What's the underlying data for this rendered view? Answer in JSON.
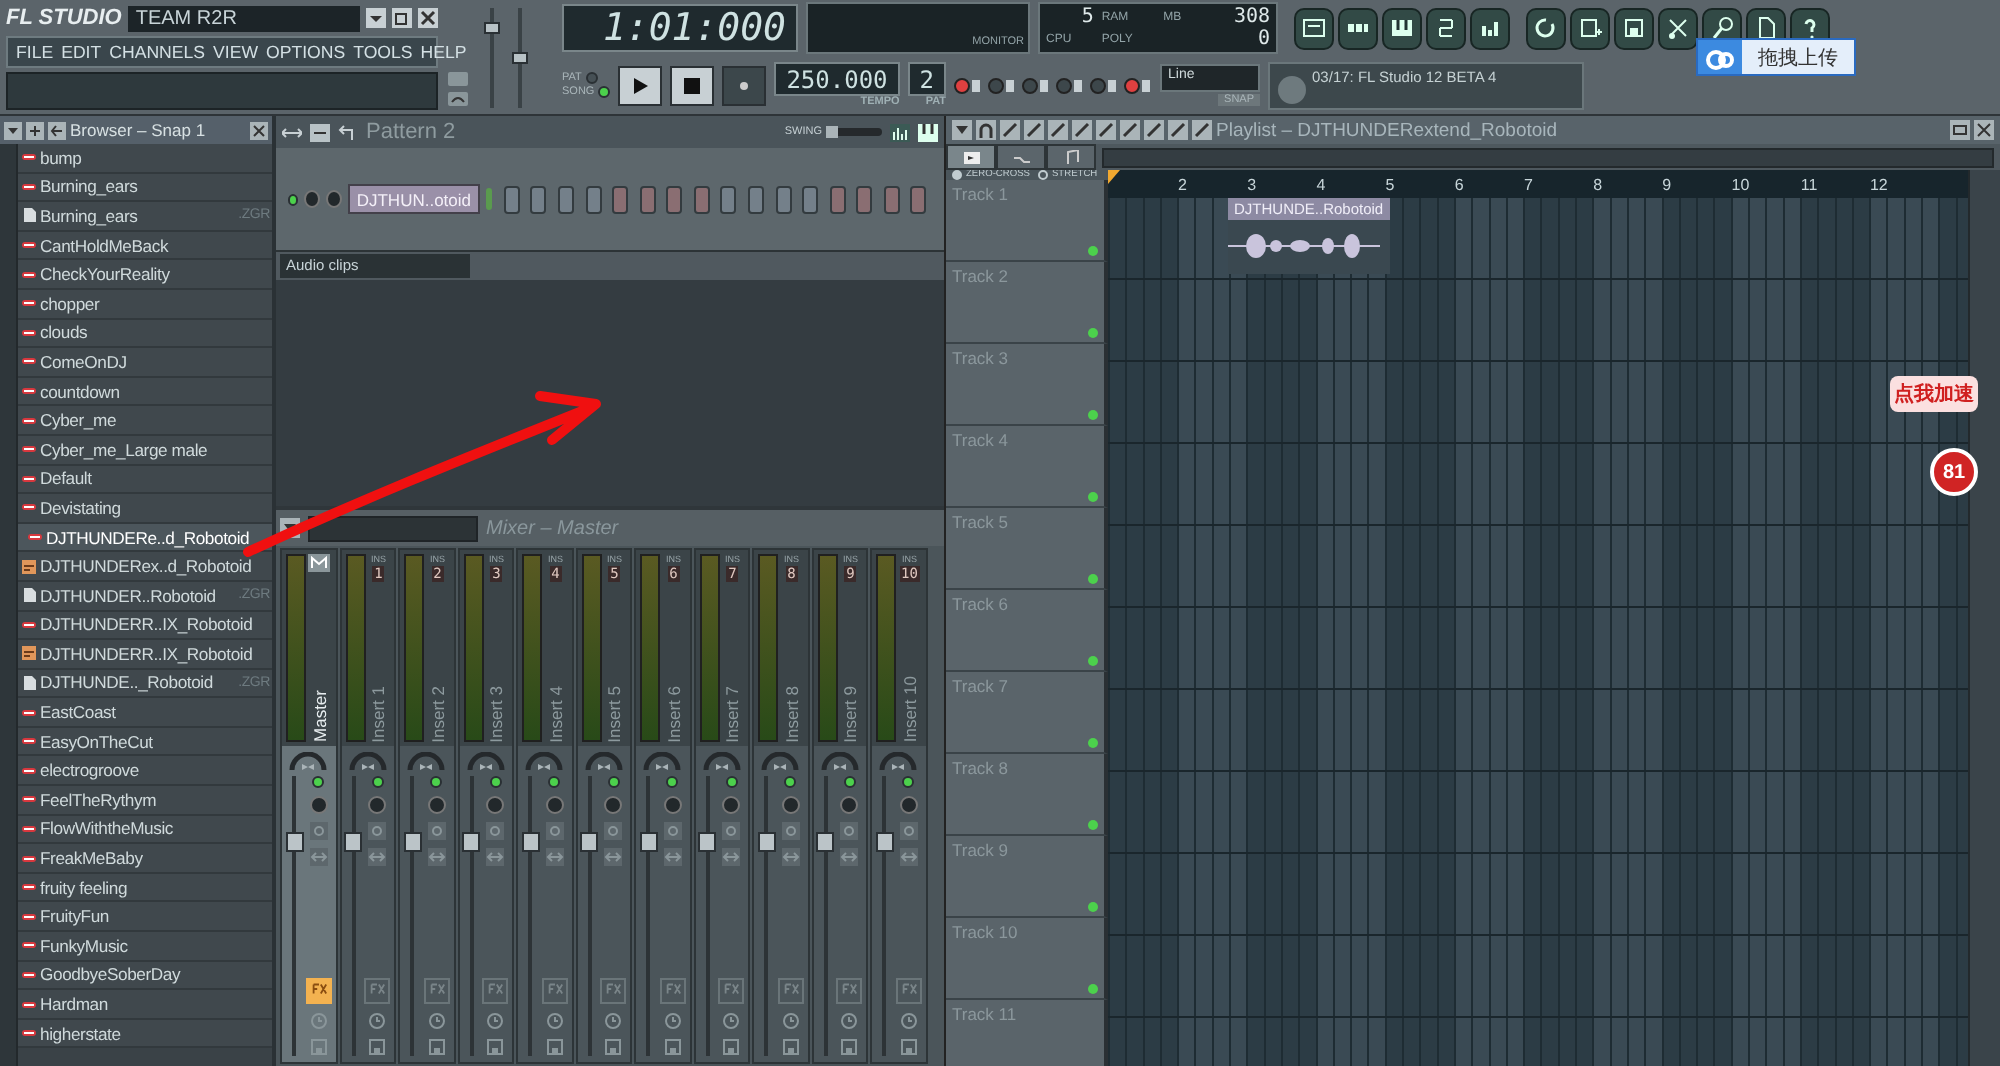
{
  "window": {
    "logo": "FL STUDIO",
    "title": "TEAM R2R"
  },
  "menu": [
    "FILE",
    "EDIT",
    "CHANNELS",
    "VIEW",
    "OPTIONS",
    "TOOLS",
    "HELP"
  ],
  "master_sliders": [
    {
      "level": 0.8
    },
    {
      "level": 0.5
    }
  ],
  "transport": {
    "time": "1:01:000",
    "modes": [
      {
        "label": "PAT",
        "selected": false
      },
      {
        "label": "SONG",
        "selected": true
      }
    ],
    "tempo": "250.000",
    "tempo_label": "TEMPO",
    "pattern": "2",
    "pattern_label": "PAT"
  },
  "monitor": {
    "label": "MONITOR"
  },
  "cpu": {
    "value_1": "5",
    "value_2": "308",
    "ram_label": "RAM",
    "mb_label": "MB",
    "cpu_label": "CPU",
    "poly_label": "POLY",
    "poly": "0"
  },
  "snap": {
    "value": "Line",
    "label": "SNAP"
  },
  "news": "03/17: FL Studio 12 BETA 4",
  "upload_tip": "拖拽上传",
  "browser": {
    "title": "Browser – Snap 1",
    "items": [
      {
        "label": "bump",
        "kind": "preset",
        "selected": false
      },
      {
        "label": "Burning_ears",
        "kind": "preset",
        "selected": false
      },
      {
        "label": "Burning_ears",
        "ext": ".ZGR",
        "kind": "file",
        "selected": false
      },
      {
        "label": "CantHoldMeBack",
        "kind": "preset",
        "selected": false
      },
      {
        "label": "CheckYourReality",
        "kind": "preset",
        "selected": false
      },
      {
        "label": "chopper",
        "kind": "preset",
        "selected": false
      },
      {
        "label": "clouds",
        "kind": "preset",
        "selected": false
      },
      {
        "label": "ComeOnDJ",
        "kind": "preset",
        "selected": false
      },
      {
        "label": "countdown",
        "kind": "preset",
        "selected": false
      },
      {
        "label": "Cyber_me",
        "kind": "preset",
        "selected": false
      },
      {
        "label": "Cyber_me_Large male",
        "kind": "preset",
        "selected": false
      },
      {
        "label": "Default",
        "kind": "preset",
        "selected": false
      },
      {
        "label": "Devistating",
        "kind": "preset",
        "selected": false
      },
      {
        "label": "DJTHUNDERe..d_Robotoid",
        "kind": "preset",
        "selected": true
      },
      {
        "label": "DJTHUNDERex..d_Robotoid",
        "kind": "audio",
        "selected": false
      },
      {
        "label": "DJTHUNDER..Robotoid",
        "ext": ".ZGR",
        "kind": "file",
        "selected": false
      },
      {
        "label": "DJTHUNDERR..IX_Robotoid",
        "kind": "preset",
        "selected": false
      },
      {
        "label": "DJTHUNDERR..IX_Robotoid",
        "kind": "audio",
        "selected": false
      },
      {
        "label": "DJTHUNDE.._Robotoid",
        "ext": ".ZGR",
        "kind": "file",
        "selected": false
      },
      {
        "label": "EastCoast",
        "kind": "preset",
        "selected": false
      },
      {
        "label": "EasyOnTheCut",
        "kind": "preset",
        "selected": false
      },
      {
        "label": "electrogroove",
        "kind": "preset",
        "selected": false
      },
      {
        "label": "FeelTheRythym",
        "kind": "preset",
        "selected": false
      },
      {
        "label": "FlowWiththeMusic",
        "kind": "preset",
        "selected": false
      },
      {
        "label": "FreakMeBaby",
        "kind": "preset",
        "selected": false
      },
      {
        "label": "fruity feeling",
        "kind": "preset",
        "selected": false
      },
      {
        "label": "FruityFun",
        "kind": "preset",
        "selected": false
      },
      {
        "label": "FunkyMusic",
        "kind": "preset",
        "selected": false
      },
      {
        "label": "GoodbyeSoberDay",
        "kind": "preset",
        "selected": false
      },
      {
        "label": "Hardman",
        "kind": "preset",
        "selected": false
      },
      {
        "label": "higherstate",
        "kind": "preset",
        "selected": false
      }
    ]
  },
  "channel_rack": {
    "title": "Pattern 2",
    "swing_label": "SWING",
    "swing": {
      "level": 0.05
    },
    "channel": "DJTHUN..otoid",
    "filter": "Audio clips",
    "steps": [
      {
        "on": false
      },
      {
        "on": false
      },
      {
        "on": false
      },
      {
        "on": false
      },
      {
        "on": false
      },
      {
        "on": false
      },
      {
        "on": false
      },
      {
        "on": false
      },
      {
        "on": false
      },
      {
        "on": false
      },
      {
        "on": false
      },
      {
        "on": false
      },
      {
        "on": false
      },
      {
        "on": false
      },
      {
        "on": false
      },
      {
        "on": false
      }
    ]
  },
  "mixer": {
    "title": "Mixer – Master",
    "strips": [
      {
        "name": "Master",
        "selected": true,
        "fx": true
      },
      {
        "name": "Insert 1",
        "ins_label": "INS",
        "number": "1",
        "selected": false,
        "fx": false
      },
      {
        "name": "Insert 2",
        "ins_label": "INS",
        "number": "2",
        "selected": false,
        "fx": false
      },
      {
        "name": "Insert 3",
        "ins_label": "INS",
        "number": "3",
        "selected": false,
        "fx": false
      },
      {
        "name": "Insert 4",
        "ins_label": "INS",
        "number": "4",
        "selected": false,
        "fx": false
      },
      {
        "name": "Insert 5",
        "ins_label": "INS",
        "number": "5",
        "selected": false,
        "fx": false
      },
      {
        "name": "Insert 6",
        "ins_label": "INS",
        "number": "6",
        "selected": false,
        "fx": false
      },
      {
        "name": "Insert 7",
        "ins_label": "INS",
        "number": "7",
        "selected": false,
        "fx": false
      },
      {
        "name": "Insert 8",
        "ins_label": "INS",
        "number": "8",
        "selected": false,
        "fx": false
      },
      {
        "name": "Insert 9",
        "ins_label": "INS",
        "number": "9",
        "selected": false,
        "fx": false
      },
      {
        "name": "Insert 10",
        "ins_label": "INS",
        "number": "10",
        "selected": false,
        "fx": false
      }
    ]
  },
  "playlist": {
    "title": "Playlist – DJTHUNDERextend_Robotoid",
    "tabs": [
      {
        "kind": "clips",
        "selected": true
      },
      {
        "kind": "automation",
        "selected": false
      },
      {
        "kind": "notes",
        "selected": false
      }
    ],
    "options": [
      {
        "label": "ZERO-CROSS",
        "selected": true
      },
      {
        "label": "STRETCH",
        "selected": false
      }
    ],
    "ruler": [
      "2",
      "3",
      "4",
      "5",
      "6",
      "7",
      "8",
      "9",
      "10",
      "11",
      "12"
    ],
    "tracks": [
      {
        "name": "Track 1",
        "clips": [
          {
            "label": "DJTHUNDE..Robotoid"
          }
        ]
      },
      {
        "name": "Track 2"
      },
      {
        "name": "Track 3"
      },
      {
        "name": "Track 4"
      },
      {
        "name": "Track 5"
      },
      {
        "name": "Track 6"
      },
      {
        "name": "Track 7"
      },
      {
        "name": "Track 8"
      },
      {
        "name": "Track 9"
      },
      {
        "name": "Track 10"
      },
      {
        "name": "Track 11"
      }
    ]
  },
  "accelerator": {
    "bubble": "点我加速",
    "badge": "81"
  }
}
